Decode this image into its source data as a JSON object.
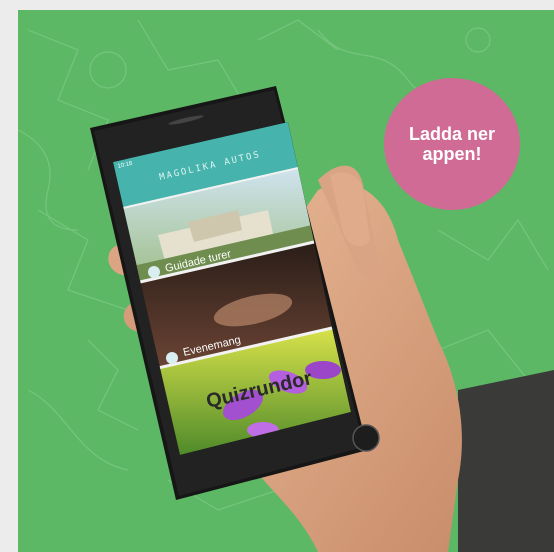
{
  "badge": {
    "text": "Ladda ner\nappen!",
    "color": "#cf6b94"
  },
  "app": {
    "title": "MAGOLIKA AUTOS",
    "status_time": "10:18",
    "cards": [
      {
        "label": "Guidade turer",
        "icon": "globe-icon"
      },
      {
        "label": "Evenemang",
        "icon": "globe-icon"
      },
      {
        "label": "Quizrundor",
        "icon": "none"
      }
    ]
  },
  "colors": {
    "background": "#5cb865",
    "app_header": "#46b3ad",
    "phone": "#1a1a1a"
  }
}
